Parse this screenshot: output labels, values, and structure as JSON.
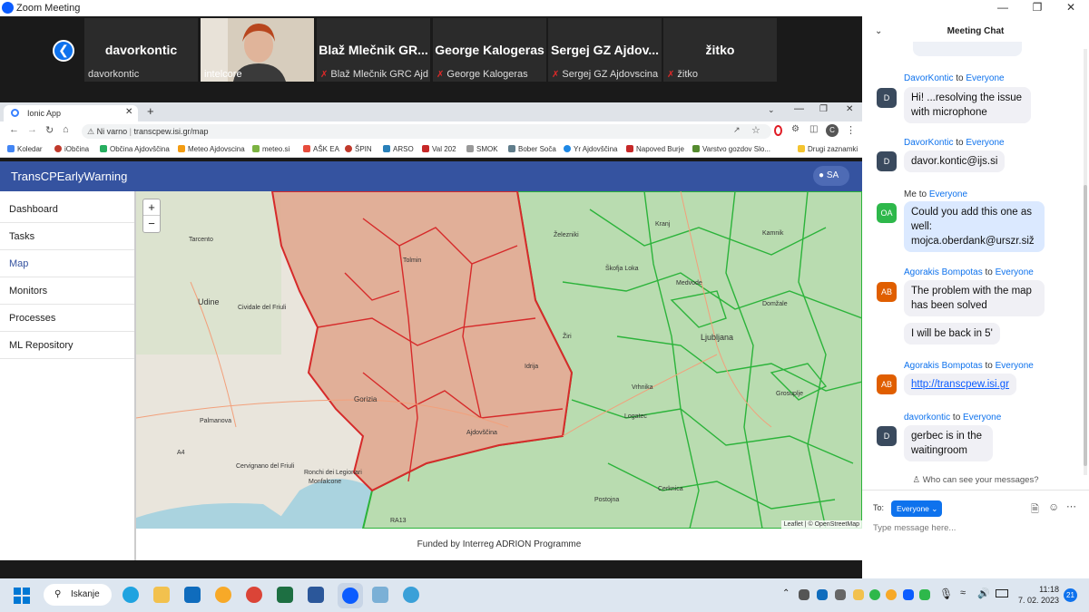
{
  "zoom": {
    "title": "Zoom Meeting"
  },
  "participants": [
    {
      "display": "davorkontic",
      "name": "davorkontic",
      "muted": false
    },
    {
      "display": "",
      "name": "intelcore",
      "muted": false
    },
    {
      "display": "Blaž Mlečnik GR...",
      "name": "Blaž Mlečnik GRC Ajdo...",
      "muted": true
    },
    {
      "display": "George Kalogeras",
      "name": "George Kalogeras",
      "muted": true
    },
    {
      "display": "Sergej GZ Ajdov...",
      "name": "Sergej GZ Ajdovscina",
      "muted": true
    },
    {
      "display": "žitko",
      "name": "žitko",
      "muted": true
    }
  ],
  "browser": {
    "tab_title": "Ionic App",
    "security": "Ni varno",
    "url": "transcpew.isi.gr/map",
    "profile": "C",
    "bookmarks": [
      "Koledar",
      "iObčina",
      "Občina Ajdovščina",
      "Meteo Ajdovscina",
      "meteo.si",
      "AŠK EA",
      "ŠPIN",
      "ARSO",
      "Val 202",
      "SMOK",
      "Bober Soča",
      "Yr Ajdovščina",
      "Napoved Burje",
      "Varstvo gozdov Slo...",
      "Drugi zaznamki"
    ]
  },
  "app": {
    "brand": "TransCPEarlyWarning",
    "user": "SA",
    "nav": [
      "Dashboard",
      "Tasks",
      "Map",
      "Monitors",
      "Processes",
      "ML Repository"
    ],
    "active_nav": "Map",
    "footer": "Funded by Interreg ADRION Programme",
    "map": {
      "zoom_in": "+",
      "zoom_out": "−",
      "attribution": "Leaflet | © OpenStreetMap",
      "places": [
        "Tarcento",
        "Udine",
        "Cividale del Friuli",
        "Gorizia",
        "Palmanova",
        "Cervignano del Friuli",
        "Ronchi dei Legionari",
        "Monfalcone",
        "Tolmin",
        "Idrija",
        "Ajdovščina",
        "Žiri",
        "Vrhnika",
        "Logatec",
        "Postojna",
        "Cerknica",
        "Ljubljana",
        "Kranj",
        "Škofja Loka",
        "Medvode",
        "Kamnik",
        "Domžale",
        "Grosuplje",
        "Železniki",
        "A4",
        "RA13"
      ]
    }
  },
  "chat": {
    "title": "Meeting Chat",
    "messages": [
      {
        "sender": "DavorKontic",
        "to": "Everyone",
        "avatar": "D",
        "color": "#3a4a5e",
        "texts": [
          "Hi! ...resolving the issue with microphone"
        ]
      },
      {
        "sender": "DavorKontic",
        "to": "Everyone",
        "avatar": "D",
        "color": "#3a4a5e",
        "texts": [
          "davor.kontic@ijs.si"
        ]
      },
      {
        "sender": "Me",
        "to": "Everyone",
        "avatar": "OA",
        "color": "#2eb84b",
        "texts": [
          "Could you add this one as well: mojca.oberdank@urszr.siž"
        ]
      },
      {
        "sender": "Agorakis Bompotas",
        "to": "Everyone",
        "avatar": "AB",
        "color": "#e05e00",
        "texts": [
          "The problem with the map has been solved",
          "I will be back in 5'"
        ]
      },
      {
        "sender": "Agorakis Bompotas",
        "to": "Everyone",
        "avatar": "AB",
        "color": "#e05e00",
        "texts": [
          "http://transcpew.isi.gr"
        ]
      },
      {
        "sender": "davorkontic",
        "to": "Everyone",
        "avatar": "D",
        "color": "#3a4a5e",
        "texts": [
          "gerbec is in the waitingroom"
        ]
      }
    ],
    "to_word": "to",
    "who": "Who can see your messages?",
    "to_label": "To:",
    "recipient": "Everyone",
    "placeholder": "Type message here..."
  },
  "taskbar": {
    "search": "Iskanje",
    "time": "11:18",
    "date": "7. 02. 2023",
    "notifications": "21"
  }
}
